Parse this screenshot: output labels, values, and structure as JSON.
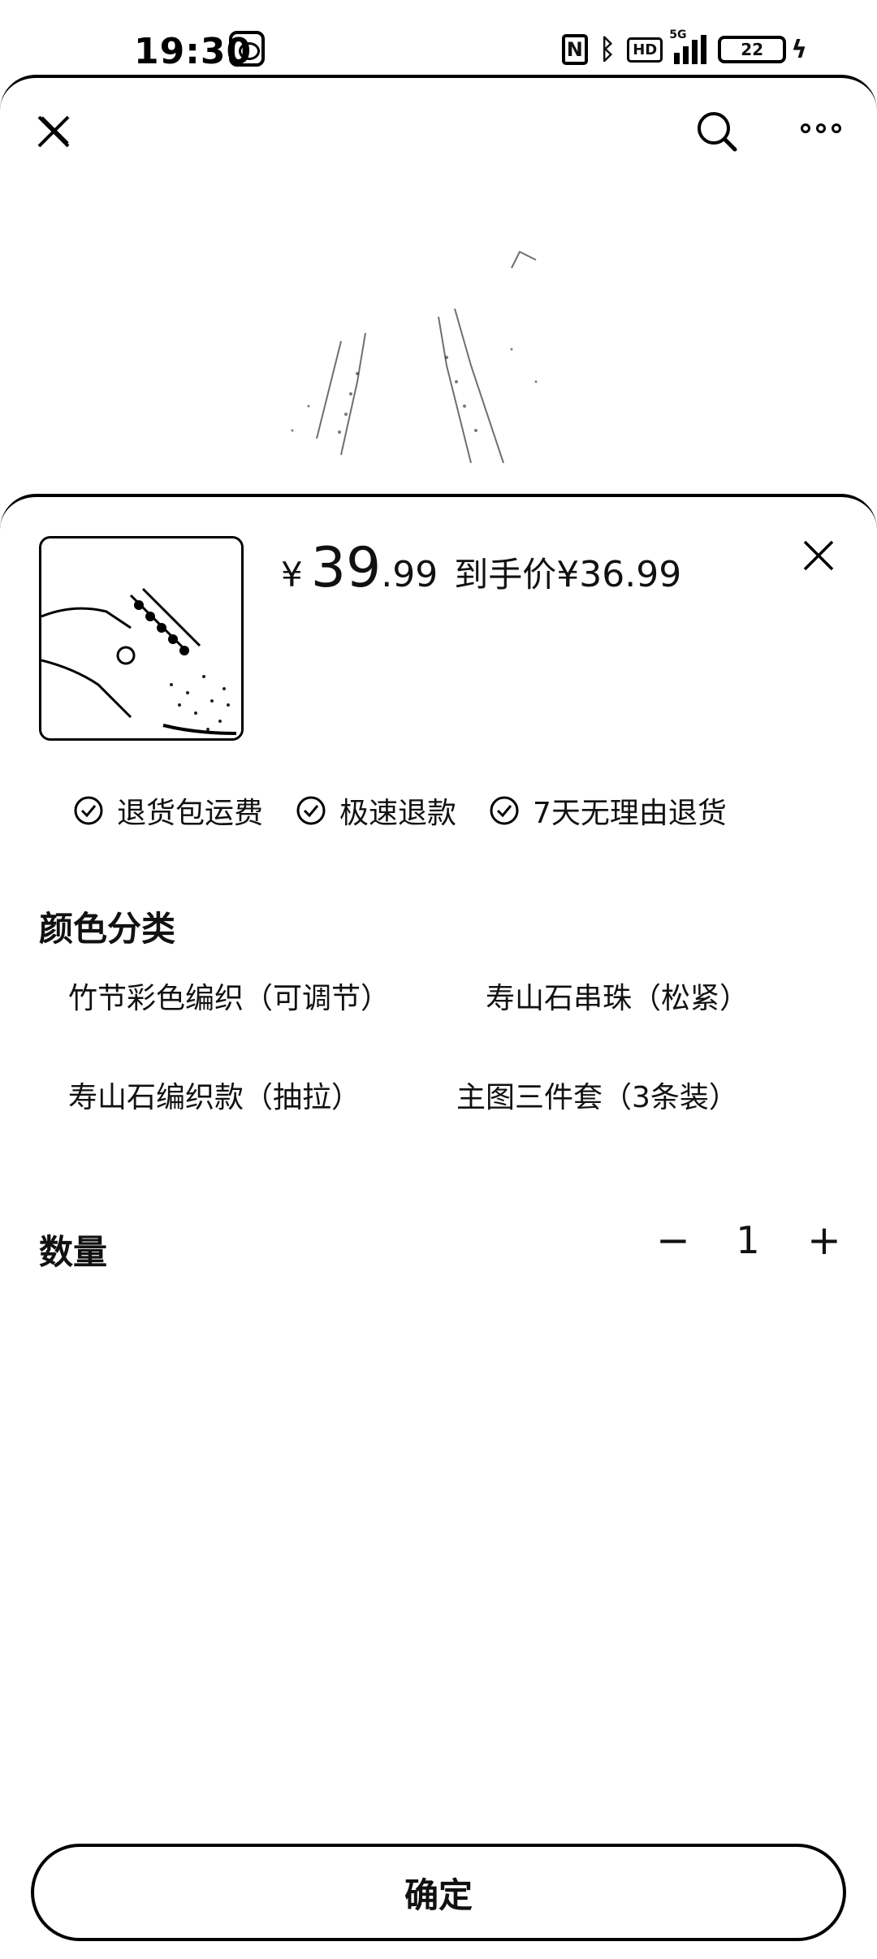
{
  "status_bar": {
    "time": "19:30",
    "network": "5G",
    "hd": "HD",
    "nfc": "N",
    "battery": "22"
  },
  "header": {
    "close_icon": "close-icon",
    "search_icon": "search-icon",
    "more_icon": "more-icon"
  },
  "sheet": {
    "price_symbol": "¥",
    "price_int": "39",
    "price_dec": ".99",
    "net_label": "到手价",
    "net_value": "¥36.99",
    "guarantees": [
      "退货包运费",
      "极速退款",
      "7天无理由退货"
    ],
    "color_section_title": "颜色分类",
    "options": [
      "竹节彩色编织（可调节）",
      "寿山石串珠（松紧）",
      "寿山石编织款（抽拉）",
      "主图三件套（3条装）"
    ],
    "quantity_label": "数量",
    "quantity_minus": "−",
    "quantity_value": "1",
    "quantity_plus": "+",
    "confirm_label": "确定"
  }
}
